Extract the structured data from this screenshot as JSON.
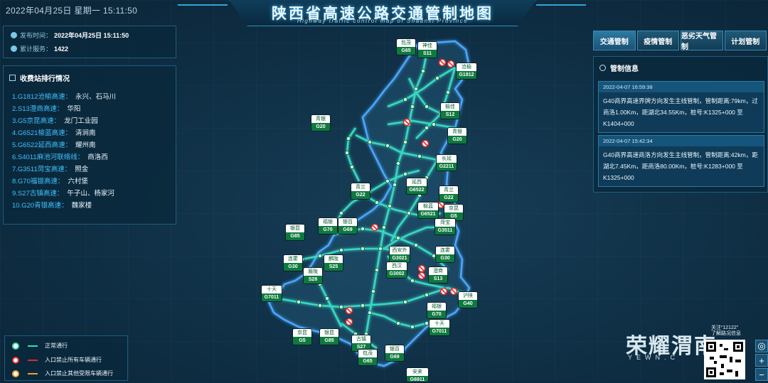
{
  "header": {
    "datetime": "2022年04月25日 星期一  15:11:50",
    "title_cn": "陕西省高速公路交通管制地图",
    "title_en": "Highway traffic control map of Shaanxi Province"
  },
  "info": {
    "publish_label": "发布时间：",
    "publish_value": "2022年04月25日 15:11:50",
    "service_label": "累计服务：",
    "service_value": "1422"
  },
  "ranking": {
    "title": "收费站排行情况",
    "items": [
      {
        "road": "1.G1812沧榆高速：",
        "station": "永兴、石马川"
      },
      {
        "road": "2.S13澄商高速：",
        "station": "华阳"
      },
      {
        "road": "3.G5京昆高速：",
        "station": "龙门工业园"
      },
      {
        "road": "4.G6521榆蓝高速：",
        "station": "清涧南"
      },
      {
        "road": "5.G6522延西高速：",
        "station": "耀州南"
      },
      {
        "road": "6.S4011麻池河联络线：",
        "station": "商洛西"
      },
      {
        "road": "7.G3511菏宝高速：",
        "station": "照金"
      },
      {
        "road": "8.G70福银高速：",
        "station": "六村堡"
      },
      {
        "road": "9.S27古镇高速：",
        "station": "午子山、杨家河"
      },
      {
        "road": "10.G20青银高速：",
        "station": "魏家楼"
      }
    ]
  },
  "tabs": [
    "交通管制",
    "疫情管制",
    "恶劣天气管制",
    "计划管制"
  ],
  "control": {
    "title": "管制信息",
    "notices": [
      {
        "time": "2022-04-07 16:59:38",
        "body": "G40商界高速界牌方向发生主线管制，管制距离:79km，过商洛1.00Km，距湖北34.55Km，桩号:K1325+000 至 K1404+000"
      },
      {
        "time": "2022-04-07 15:42:34",
        "body": "G40商界高速商洛方向发生主线管制，管制距离:42km，距湖北7.45Km，距商洛80.00Km，桩号:K1283+000 至 K1325+000"
      }
    ]
  },
  "shields": [
    {
      "name": "包茂",
      "code": "G65"
    },
    {
      "name": "神佳",
      "code": "S11"
    },
    {
      "name": "沧榆",
      "code": "G1812"
    },
    {
      "name": "榆佳",
      "code": "S12"
    },
    {
      "name": "青银",
      "code": "G20"
    },
    {
      "name": "青银",
      "code": "G20"
    },
    {
      "name": "长延",
      "code": "G2211"
    },
    {
      "name": "延西",
      "code": "G6522"
    },
    {
      "name": "青兰",
      "code": "G22"
    },
    {
      "name": "青兰",
      "code": "G22"
    },
    {
      "name": "榆蓝",
      "code": "G6521"
    },
    {
      "name": "京昆",
      "code": "G5"
    },
    {
      "name": "菏宝",
      "code": "G3511"
    },
    {
      "name": "银昆",
      "code": "G85"
    },
    {
      "name": "福银",
      "code": "G70"
    },
    {
      "name": "银百",
      "code": "G69"
    },
    {
      "name": "西安外",
      "code": "G3021"
    },
    {
      "name": "连霍",
      "code": "G30"
    },
    {
      "name": "连霍",
      "code": "G30"
    },
    {
      "name": "麟陇",
      "code": "S25"
    },
    {
      "name": "眉陇",
      "code": "S28"
    },
    {
      "name": "西汉",
      "code": "G3002"
    },
    {
      "name": "澄商",
      "code": "S13"
    },
    {
      "name": "十天",
      "code": "G7011"
    },
    {
      "name": "沪陕",
      "code": "G40"
    },
    {
      "name": "福银",
      "code": "G70"
    },
    {
      "name": "十天",
      "code": "G7011"
    },
    {
      "name": "京昆",
      "code": "G5"
    },
    {
      "name": "银昆",
      "code": "G85"
    },
    {
      "name": "古镇",
      "code": "S27"
    },
    {
      "name": "包茂",
      "code": "G65"
    },
    {
      "name": "银百",
      "code": "G69"
    },
    {
      "name": "安来",
      "code": "G6911"
    }
  ],
  "legend": [
    {
      "label": "正常通行",
      "color": "#33e0b0"
    },
    {
      "label": "入口禁止所有车辆通行",
      "color": "#e02a2a"
    },
    {
      "label": "入口禁止其他受限车辆通行",
      "color": "#f0a030"
    }
  ],
  "watermark": {
    "cn": "荣耀渭南",
    "en": "YEWN.C",
    "qr_caption": "关注“12122”\n了解路况信息"
  },
  "colors": {
    "route": "#37d7c2",
    "route_glow": "#1fa7b0",
    "province_border": "#4aa8ff",
    "node": "#c9ffd8"
  }
}
